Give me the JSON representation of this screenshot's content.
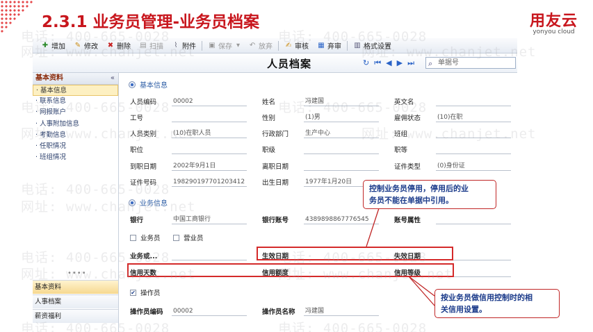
{
  "slide": {
    "title": "2.3.1 业务员管理-业务员档案",
    "logo_main": "用友云",
    "logo_sub": "yonyou cloud"
  },
  "watermark": {
    "phone": "电话: 400-665-0028",
    "site": "网址: www.chanjet.net"
  },
  "toolbar": {
    "add": "增加",
    "edit": "修改",
    "delete": "删除",
    "scan": "扫描",
    "attach": "附件",
    "save": "保存",
    "abandon": "放弃",
    "audit": "审核",
    "unaudit": "弃审",
    "format": "格式设置"
  },
  "header": {
    "title": "人员档案",
    "search_placeholder": "单据号"
  },
  "leftnav": {
    "head": "基本资料",
    "items": [
      "· 基本信息",
      "· 联系信息",
      "· 网报账户",
      "· 人事附加信息",
      "· 考勤信息",
      "· 任职情况",
      "· 班组情况"
    ],
    "dots": "••••",
    "sections": [
      "基本资料",
      "人事档案",
      "薪资福利"
    ]
  },
  "form": {
    "basic_title": "基本信息",
    "labels": {
      "emp_code": "人员编码",
      "name": "姓名",
      "en_name": "英文名",
      "job_no": "工号",
      "gender": "性别",
      "emp_status": "雇佣状态",
      "emp_type": "人员类别",
      "dept": "行政部门",
      "team": "班组",
      "position": "职位",
      "rank": "职级",
      "grade": "职等",
      "hire_date": "到职日期",
      "leave_date": "离职日期",
      "id_type": "证件类型",
      "id_no": "证件号码",
      "birth_date": "出生日期",
      "bank": "银行",
      "bank_acct": "银行账号",
      "acct_attr": "账号属性",
      "salesman": "业务员",
      "operator_chk": "营业员",
      "biz_dept": "业务或...",
      "eff_date": "生效日期",
      "exp_date": "失效日期",
      "credit_days": "信用天数",
      "credit_amt": "信用额度",
      "credit_grade": "信用等级",
      "is_operator": "操作员",
      "op_code": "操作员编码",
      "op_name": "操作员名称"
    },
    "values": {
      "emp_code": "00002",
      "name": "冯建国",
      "gender": "(1)男",
      "emp_status": "(10)在职",
      "emp_type": "(10)在职人员",
      "dept": "生产中心",
      "hire_date": "2002年9月1日",
      "id_type": "(0)身份证",
      "id_no": "198290197701203412",
      "birth_date": "1977年1月20日",
      "bank": "中国工商银行",
      "bank_acct": "4389898867776545",
      "op_code": "00002",
      "op_name": "冯建国"
    },
    "biz_title": "业务信息"
  },
  "callouts": {
    "top": [
      "控制业务员停用，停用后的业",
      "务员不能在单据中引用。"
    ],
    "bottom": [
      "按业务员做信用控制时的相",
      "关信用设置。"
    ]
  }
}
